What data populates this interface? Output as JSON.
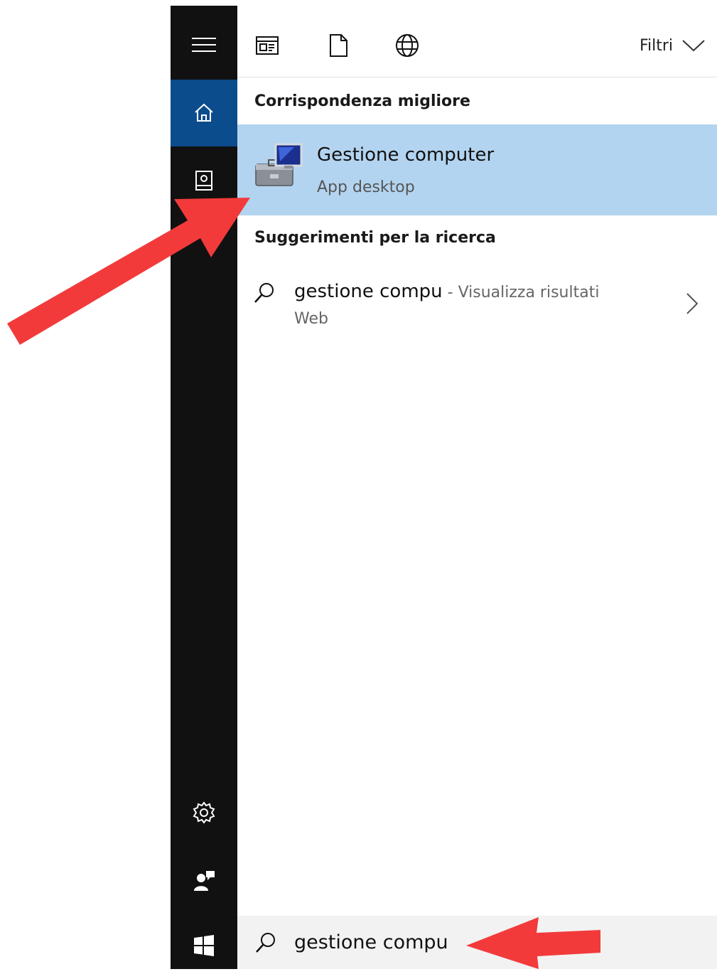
{
  "toolbar": {
    "filters_label": "Filtri",
    "icons": [
      "apps-icon",
      "document-icon",
      "web-icon"
    ]
  },
  "sidebar": {
    "items": [
      "menu-icon",
      "home-icon",
      "notebook-icon",
      "settings-icon",
      "feedback-icon",
      "windows-icon"
    ]
  },
  "best_match": {
    "section_title": "Corrispondenza migliore",
    "title": "Gestione computer",
    "subtitle": "App desktop"
  },
  "suggestions": {
    "section_title": "Suggerimenti per la ricerca",
    "query": "gestione compu",
    "separator": " - ",
    "action": "Visualizza risultati",
    "action_cont": "Web"
  },
  "search": {
    "value": "gestione compu"
  },
  "colors": {
    "sidebar_bg": "#111111",
    "active_bg": "#0b4c8c",
    "highlight_bg": "#b3d4f0",
    "annotation_arrow": "#f23a3a"
  }
}
